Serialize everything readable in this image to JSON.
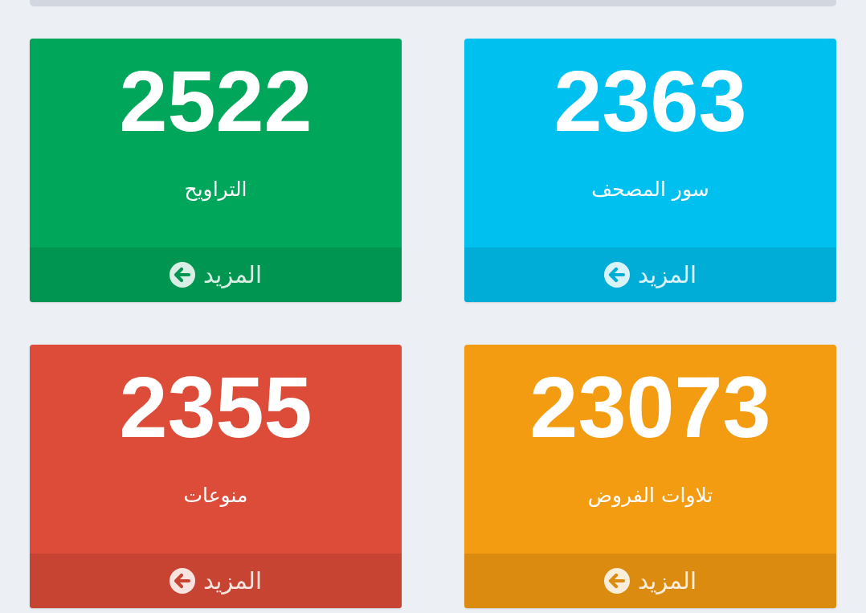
{
  "cards": [
    {
      "value": "2363",
      "label": "سور المصحف",
      "color": "#00c0ef",
      "link": "المزيد"
    },
    {
      "value": "2522",
      "label": "التراويح",
      "color": "#00a65a",
      "link": "المزيد"
    },
    {
      "value": "23073",
      "label": "تلاوات الفروض",
      "color": "#f39c12",
      "link": "المزيد"
    },
    {
      "value": "2355",
      "label": "منوعات",
      "color": "#dd4b39",
      "link": "المزيد"
    }
  ]
}
